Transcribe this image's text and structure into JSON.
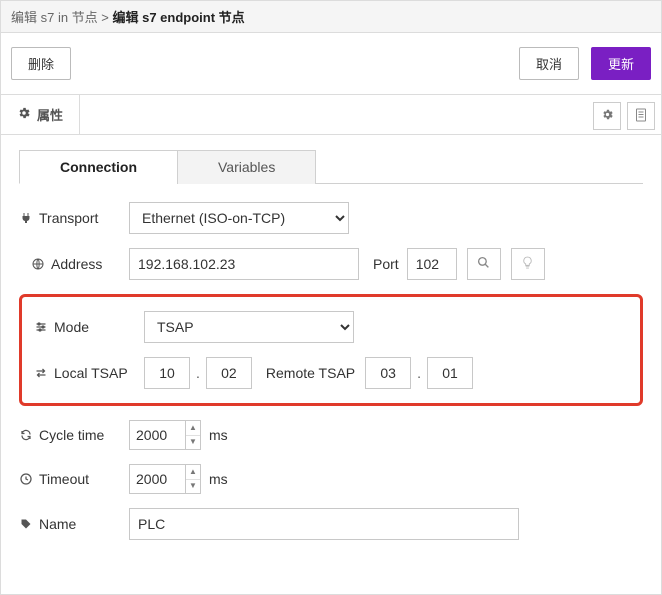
{
  "breadcrumb": {
    "part1": "编辑 s7 in 节点 > ",
    "part2": "编辑 s7 endpoint 节点"
  },
  "actions": {
    "delete": "删除",
    "cancel": "取消",
    "update": "更新"
  },
  "top_tabs": {
    "properties": "属性"
  },
  "inner_tabs": {
    "connection": "Connection",
    "variables": "Variables"
  },
  "fields": {
    "transport_label": "Transport",
    "transport_value": "Ethernet (ISO-on-TCP)",
    "address_label": "Address",
    "address_value": "192.168.102.23",
    "port_label": "Port",
    "port_value": "102",
    "mode_label": "Mode",
    "mode_value": "TSAP",
    "local_tsap_label": "Local TSAP",
    "local_tsap_a": "10",
    "local_tsap_b": "02",
    "remote_tsap_label": "Remote TSAP",
    "remote_tsap_a": "03",
    "remote_tsap_b": "01",
    "cycle_label": "Cycle time",
    "cycle_value": "2000",
    "cycle_unit": "ms",
    "timeout_label": "Timeout",
    "timeout_value": "2000",
    "timeout_unit": "ms",
    "name_label": "Name",
    "name_value": "PLC"
  }
}
